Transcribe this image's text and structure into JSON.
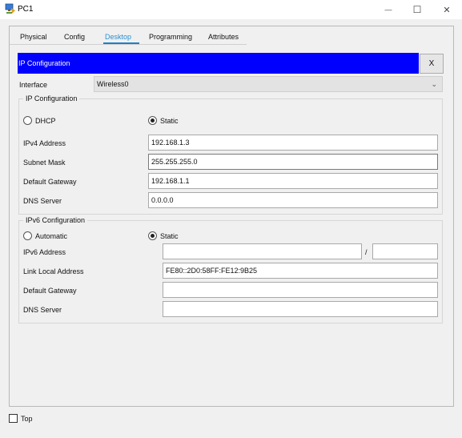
{
  "window": {
    "title": "PC1",
    "minimize_glyph": "—",
    "maximize_glyph": "☐",
    "close_glyph": "✕"
  },
  "tabs": [
    {
      "label": "Physical"
    },
    {
      "label": "Config"
    },
    {
      "label": "Desktop",
      "active": true
    },
    {
      "label": "Programming"
    },
    {
      "label": "Attributes"
    }
  ],
  "ip_config": {
    "header_title": "IP Configuration",
    "close_label": "X",
    "interface_label": "Interface",
    "interface_value": "Wireless0",
    "ipv4_section_title": "IP Configuration",
    "dhcp_label": "DHCP",
    "static_label": "Static",
    "ipv4_mode": "Static",
    "ipv4_address_label": "IPv4 Address",
    "ipv4_address": "192.168.1.3",
    "subnet_mask_label": "Subnet Mask",
    "subnet_mask": "255.255.255.0",
    "default_gateway_label": "Default Gateway",
    "default_gateway": "192.168.1.1",
    "dns_server_label": "DNS Server",
    "dns_server": "0.0.0.0",
    "ipv6_section_title": "IPv6 Configuration",
    "automatic_label": "Automatic",
    "ipv6_static_label": "Static",
    "ipv6_mode": "Static",
    "ipv6_address_label": "IPv6 Address",
    "ipv6_address": "",
    "ipv6_prefix_sep": "/",
    "ipv6_prefix": "",
    "link_local_label": "Link Local Address",
    "link_local": "FE80::2D0:58FF:FE12:9B25",
    "ipv6_gateway_label": "Default Gateway",
    "ipv6_gateway": "",
    "ipv6_dns_label": "DNS Server",
    "ipv6_dns": ""
  },
  "footer": {
    "top_label": "Top",
    "top_checked": false
  },
  "colors": {
    "header_blue": "#0000ff",
    "active_tab": "#2b8fd2"
  }
}
